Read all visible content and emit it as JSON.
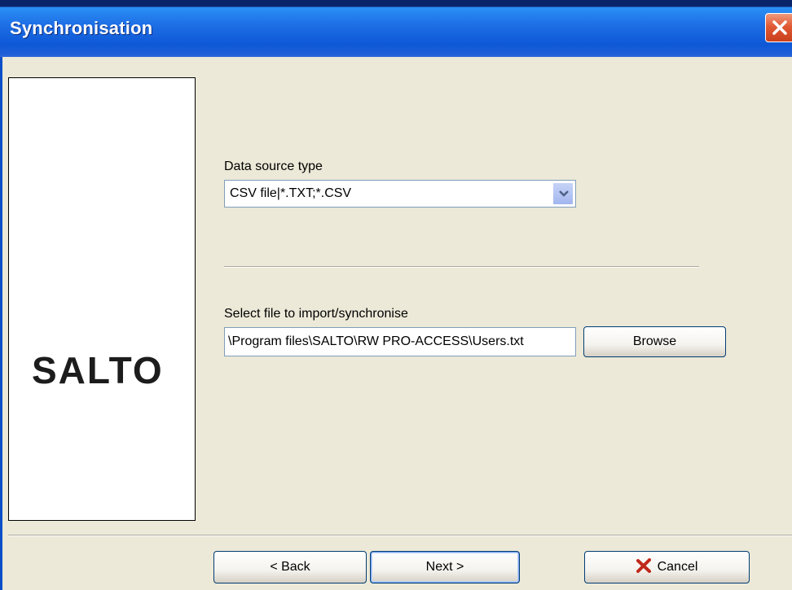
{
  "window": {
    "title": "Synchronisation"
  },
  "logo": {
    "text": "SALTO"
  },
  "data_source": {
    "label": "Data source type",
    "selected": "CSV file|*.TXT;*.CSV"
  },
  "file_import": {
    "label": "Select file to import/synchronise",
    "value": "\\Program files\\SALTO\\RW PRO-ACCESS\\Users.txt",
    "browse_label": "Browse"
  },
  "footer": {
    "back_label": "< Back",
    "next_label": "Next >",
    "cancel_label": "Cancel"
  },
  "icons": {
    "close": "close-icon",
    "dropdown": "chevron-down-icon",
    "cancel": "red-x-icon"
  },
  "colors": {
    "titlebar": "#0E58D6",
    "dialog_bg": "#ECE9D8",
    "close_button": "#E15A33",
    "cancel_icon": "#C0281A"
  }
}
